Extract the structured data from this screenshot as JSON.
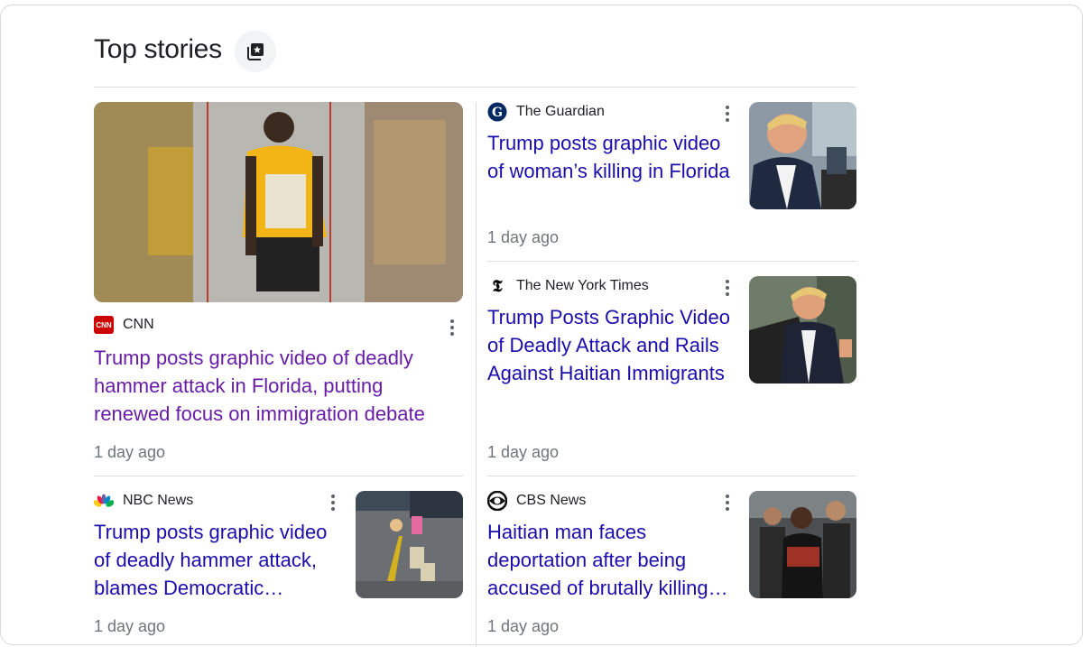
{
  "header": {
    "title": "Top stories"
  },
  "stories": [
    {
      "source": "CNN",
      "logo_text": "CNN",
      "title": "Trump posts graphic video of deadly hammer attack in Florida, putting renewed focus on immigration debate",
      "time": "1 day ago"
    },
    {
      "source": "The Guardian",
      "title": "Trump posts graphic video of woman’s killing in Florida",
      "time": "1 day ago"
    },
    {
      "source": "The New York Times",
      "logo_text": "𝕿",
      "title": "Trump Posts Graphic Video of Deadly Attack and Rails Against Haitian Immigrants",
      "time": "1 day ago"
    },
    {
      "source": "NBC News",
      "title": "Trump posts graphic video of deadly hammer attack, blames Democratic…",
      "time": "1 day ago"
    },
    {
      "source": "CBS News",
      "title": "Haitian man faces deportation after being accused of brutally killing…",
      "time": "1 day ago"
    }
  ],
  "colors": {
    "link": "#1a0dab",
    "visited": "#681da8",
    "meta": "#70757a",
    "divider": "#dadce0"
  }
}
